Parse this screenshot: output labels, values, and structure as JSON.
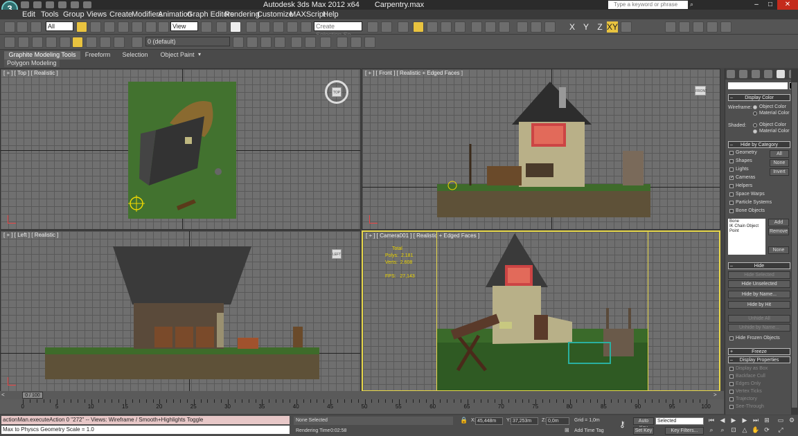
{
  "window": {
    "app_title": "Autodesk 3ds Max  2012 x64",
    "file_name": "Carpentry.max",
    "search_placeholder": "Type a keyword or phrase",
    "logo": "3"
  },
  "menu": [
    "Edit",
    "Tools",
    "Group",
    "Views",
    "Create",
    "Modifiers",
    "Animation",
    "Graph Editors",
    "Rendering",
    "Customize",
    "MAXScript",
    "Help"
  ],
  "toolbar": {
    "filter_dropdown": "All",
    "coord_dropdown": "View",
    "selection_set_placeholder": "Create Selection Se",
    "axis_buttons": [
      "X",
      "Y",
      "Z",
      "XY"
    ],
    "layer_dropdown": "0 (default)"
  },
  "ribbon": {
    "tabs": [
      "Graphite Modeling Tools",
      "Freeform",
      "Selection",
      "Object Paint"
    ],
    "active_tab": "Graphite Modeling Tools",
    "subpanel": "Polygon Modeling"
  },
  "viewports": {
    "top": {
      "label": "[ + ] [ Top ] [ Realistic ]",
      "cube_label": "TOP"
    },
    "front": {
      "label": "[ + ] [ Front ] [ Realistic + Edged Faces ]",
      "cube_label": "FRONT"
    },
    "left": {
      "label": "[ + ] [ Left ] [ Realistic ]",
      "cube_label": "LEFT"
    },
    "camera": {
      "label": "[ + ] [ Camera001 ] [ Realistic + Edged Faces ]",
      "stats_header": "Total",
      "polys_label": "Polys:",
      "polys_value": "2.181",
      "verts_label": "Verts:",
      "verts_value": "2.608",
      "fps_label": "FPS:",
      "fps_value": "27,143"
    }
  },
  "command_panel": {
    "display_color": {
      "title": "Display Color",
      "wireframe_label": "Wireframe:",
      "shaded_label": "Shaded:",
      "object_color": "Object Color",
      "material_color": "Material Color"
    },
    "hide_by_category": {
      "title": "Hide by Category",
      "items": [
        {
          "label": "Geometry",
          "checked": false
        },
        {
          "label": "Shapes",
          "checked": false
        },
        {
          "label": "Lights",
          "checked": false
        },
        {
          "label": "Cameras",
          "checked": true
        },
        {
          "label": "Helpers",
          "checked": false
        },
        {
          "label": "Space Warps",
          "checked": false
        },
        {
          "label": "Particle Systems",
          "checked": false
        },
        {
          "label": "Bone Objects",
          "checked": false
        }
      ],
      "all_button": "All",
      "none_button": "None",
      "invert_button": "Invert",
      "list_items": [
        "Bone",
        "IK Chain Object",
        "Point"
      ],
      "add_button": "Add",
      "remove_button": "Remove",
      "none_button2": "None"
    },
    "hide": {
      "title": "Hide",
      "buttons": [
        {
          "label": "Hide Selected",
          "enabled": false
        },
        {
          "label": "Hide Unselected",
          "enabled": true
        },
        {
          "label": "Hide by Name...",
          "enabled": true
        },
        {
          "label": "Hide by Hit",
          "enabled": true
        },
        {
          "label": "Unhide All",
          "enabled": false
        },
        {
          "label": "Unhide by Name...",
          "enabled": false
        }
      ],
      "hide_frozen": "Hide Frozen Objects"
    },
    "freeze": {
      "title": "Freeze"
    },
    "display_properties": {
      "title": "Display Properties",
      "items": [
        "Display as Box",
        "Backface Cull",
        "Edges Only",
        "Vertex Ticks",
        "Trajectory",
        "See-Through"
      ]
    }
  },
  "timeline": {
    "frame_indicator": "0 / 100",
    "ticks": [
      "0",
      "5",
      "10",
      "15",
      "20",
      "25",
      "30",
      "35",
      "40",
      "45",
      "50",
      "55",
      "60",
      "65",
      "70",
      "75",
      "80",
      "85",
      "90",
      "95",
      "100"
    ]
  },
  "statusbar": {
    "maxscript_line1": "actionMan.executeAction 0 \"272\"  -- Views: Wireframe / Smooth+Highlights Toggle",
    "maxscript_line2": "Max to Physcs Geometry Scale = 1.0",
    "selection_status": "None Selected",
    "rendering_time_label": "Rendering Time",
    "rendering_time_value": "0:02:58",
    "x_label": "X:",
    "x_value": "45,448m",
    "y_label": "Y:",
    "y_value": "37,253m",
    "z_label": "Z:",
    "z_value": "0,0m",
    "grid": "Grid = 1,0m",
    "add_time_tag": "Add Time Tag",
    "auto_key": "Auto Key",
    "set_key": "Set Key",
    "selected_dropdown": "Selected",
    "key_filters": "Key Filters..."
  },
  "colors": {
    "active_viewport_border": "#e8d84a",
    "highlight_button": "#e9c33f",
    "maxscript_listener_bg": "#e8c8c8",
    "close_button": "#c42b1c"
  }
}
